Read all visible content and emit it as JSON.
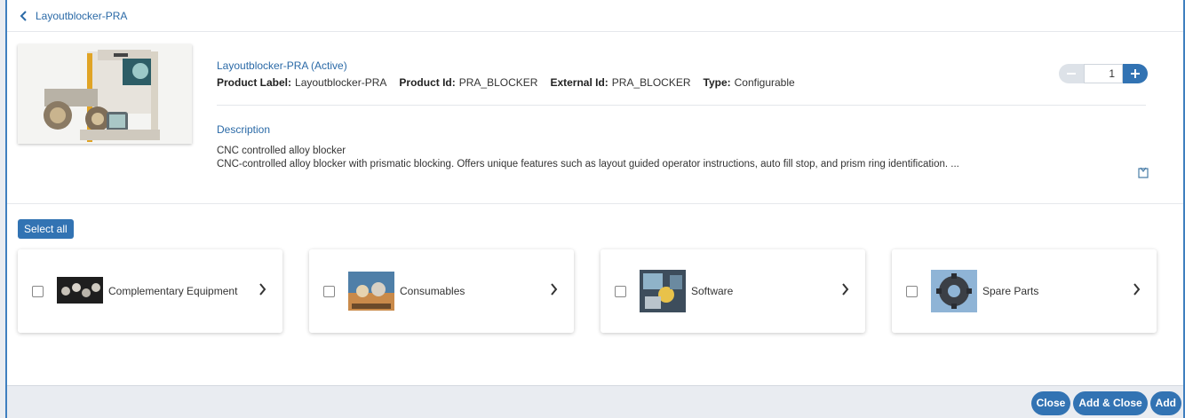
{
  "header": {
    "back_label": "Layoutblocker-PRA"
  },
  "product": {
    "title": "Layoutblocker-PRA (Active)",
    "label_key": "Product Label:",
    "label_value": "Layoutblocker-PRA",
    "id_key": "Product Id:",
    "id_value": "PRA_BLOCKER",
    "external_key": "External Id:",
    "external_value": "PRA_BLOCKER",
    "type_key": "Type:",
    "type_value": "Configurable",
    "description_title": "Description",
    "description_line1": "CNC controlled alloy blocker",
    "description_line2": "CNC-controlled alloy blocker with prismatic blocking. Offers unique features such as layout guided operator instructions, auto fill stop, and prism ring identification. ..."
  },
  "quantity": {
    "value": "1",
    "minus_icon": "minus-icon",
    "plus_icon": "plus-icon"
  },
  "select_all_label": "Select all",
  "categories": [
    {
      "label": "Complementary Equipment"
    },
    {
      "label": "Consumables"
    },
    {
      "label": "Software"
    },
    {
      "label": "Spare Parts"
    }
  ],
  "footer": {
    "close": "Close",
    "add_close": "Add & Close",
    "add": "Add"
  },
  "colors": {
    "accent": "#3273b3",
    "link": "#2b6aa7"
  }
}
